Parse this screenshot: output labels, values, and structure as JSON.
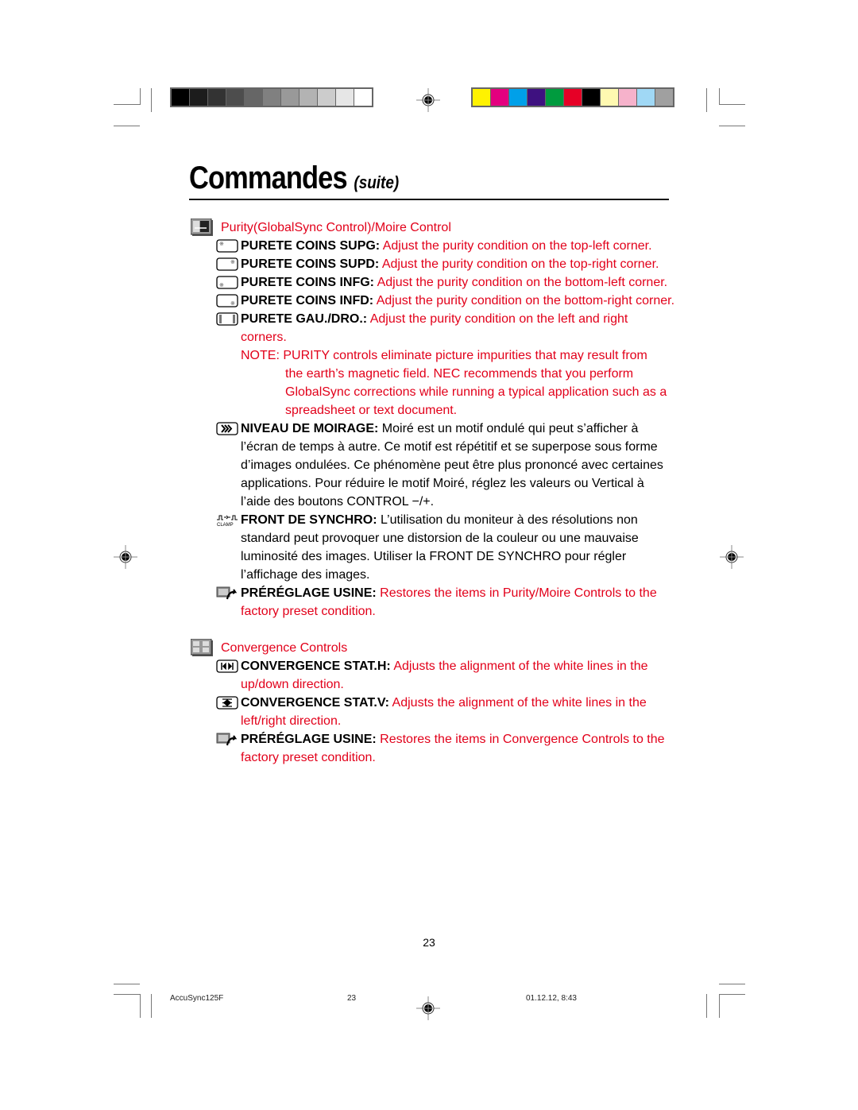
{
  "print_marks": {
    "gray_swatches": [
      "#000000",
      "#1c1c1c",
      "#333333",
      "#4d4d4d",
      "#666666",
      "#808080",
      "#999999",
      "#b3b3b3",
      "#cccccc",
      "#e6e6e6",
      "#ffffff"
    ],
    "color_swatches": [
      "#fff200",
      "#e4007f",
      "#00a0e9",
      "#3e1180",
      "#009b3e",
      "#e60026",
      "#000000",
      "#fff9b1",
      "#f6b2cb",
      "#a0d8f5",
      "#a0a0a0"
    ]
  },
  "header": {
    "title": "Commandes",
    "subtitle": "(suite)"
  },
  "colors": {
    "accent": "#e2001a"
  },
  "sections": [
    {
      "heading": "Purity(GlobalSync Control)/Moire Control",
      "icon": "purity-section-icon",
      "items": [
        {
          "icon": "corner-top-left-icon",
          "label": "PURETE COINS SUPG:",
          "text": "Adjust the purity condition on the top-left corner.",
          "color": "red"
        },
        {
          "icon": "corner-top-right-icon",
          "label": "PURETE COINS SUPD:",
          "text": "Adjust the purity condition on the top-right corner.",
          "color": "red"
        },
        {
          "icon": "corner-bottom-left-icon",
          "label": "PURETE COINS INFG:",
          "text": "Adjust the purity condition on the bottom-left corner.",
          "color": "red"
        },
        {
          "icon": "corner-bottom-right-icon",
          "label": "PURETE COINS INFD:",
          "text": "Adjust the purity condition on the bottom-right corner.",
          "color": "red"
        },
        {
          "icon": "left-right-purity-icon",
          "label": "PURETE GAU./DRO.:",
          "text": "Adjust the purity condition on the left and right corners.",
          "color": "red"
        }
      ],
      "note": {
        "prefix": "NOTE:",
        "line1": "PURITY controls eliminate picture impurities that may result from",
        "rest": "the earth’s magnetic field. NEC recommends that you perform GlobalSync corrections while running a typical application such as a spreadsheet or text document."
      },
      "items_after_note": [
        {
          "icon": "moire-icon",
          "label": "NIVEAU DE MOIRAGE:",
          "text": "Moiré est un motif ondulé qui peut s’afficher à l’écran de temps à autre. Ce motif est répétitif et se superpose sous forme d’images ondulées. Ce phénomène peut être plus prononcé avec certaines applications. Pour réduire le motif Moiré, réglez les valeurs ou Vertical à l’aide des boutons CONTROL −/+.",
          "color": "black"
        },
        {
          "icon": "clamp-icon",
          "label": "FRONT DE SYNCHRO:",
          "text": "L’utilisation du moniteur à des résolutions non standard peut provoquer une distorsion de la couleur ou une mauvaise luminosité des images. Utiliser la FRONT DE SYNCHRO pour régler l’affichage des images.",
          "color": "black",
          "icon_caption": "CLAMP"
        },
        {
          "icon": "factory-preset-icon",
          "label": "PRÉRÉGLAGE USINE:",
          "text": "Restores the items in Purity/Moire Controls to the factory preset condition.",
          "color": "red"
        }
      ]
    },
    {
      "heading": "Convergence Controls",
      "icon": "convergence-section-icon",
      "items": [
        {
          "icon": "convergence-h-icon",
          "label": "CONVERGENCE STAT.H:",
          "text": "Adjusts the alignment of the white lines in the up/down direction.",
          "color": "red"
        },
        {
          "icon": "convergence-v-icon",
          "label": "CONVERGENCE STAT.V:",
          "text": "Adjusts the alignment of the white lines in the left/right direction.",
          "color": "red"
        },
        {
          "icon": "factory-preset-icon",
          "label": "PRÉRÉGLAGE USINE:",
          "text": "Restores the items in Convergence Controls to the factory preset condition.",
          "color": "red"
        }
      ]
    }
  ],
  "page_number": "23",
  "footer": {
    "file": "AccuSync125F",
    "page": "23",
    "timestamp": "01.12.12, 8:43"
  }
}
